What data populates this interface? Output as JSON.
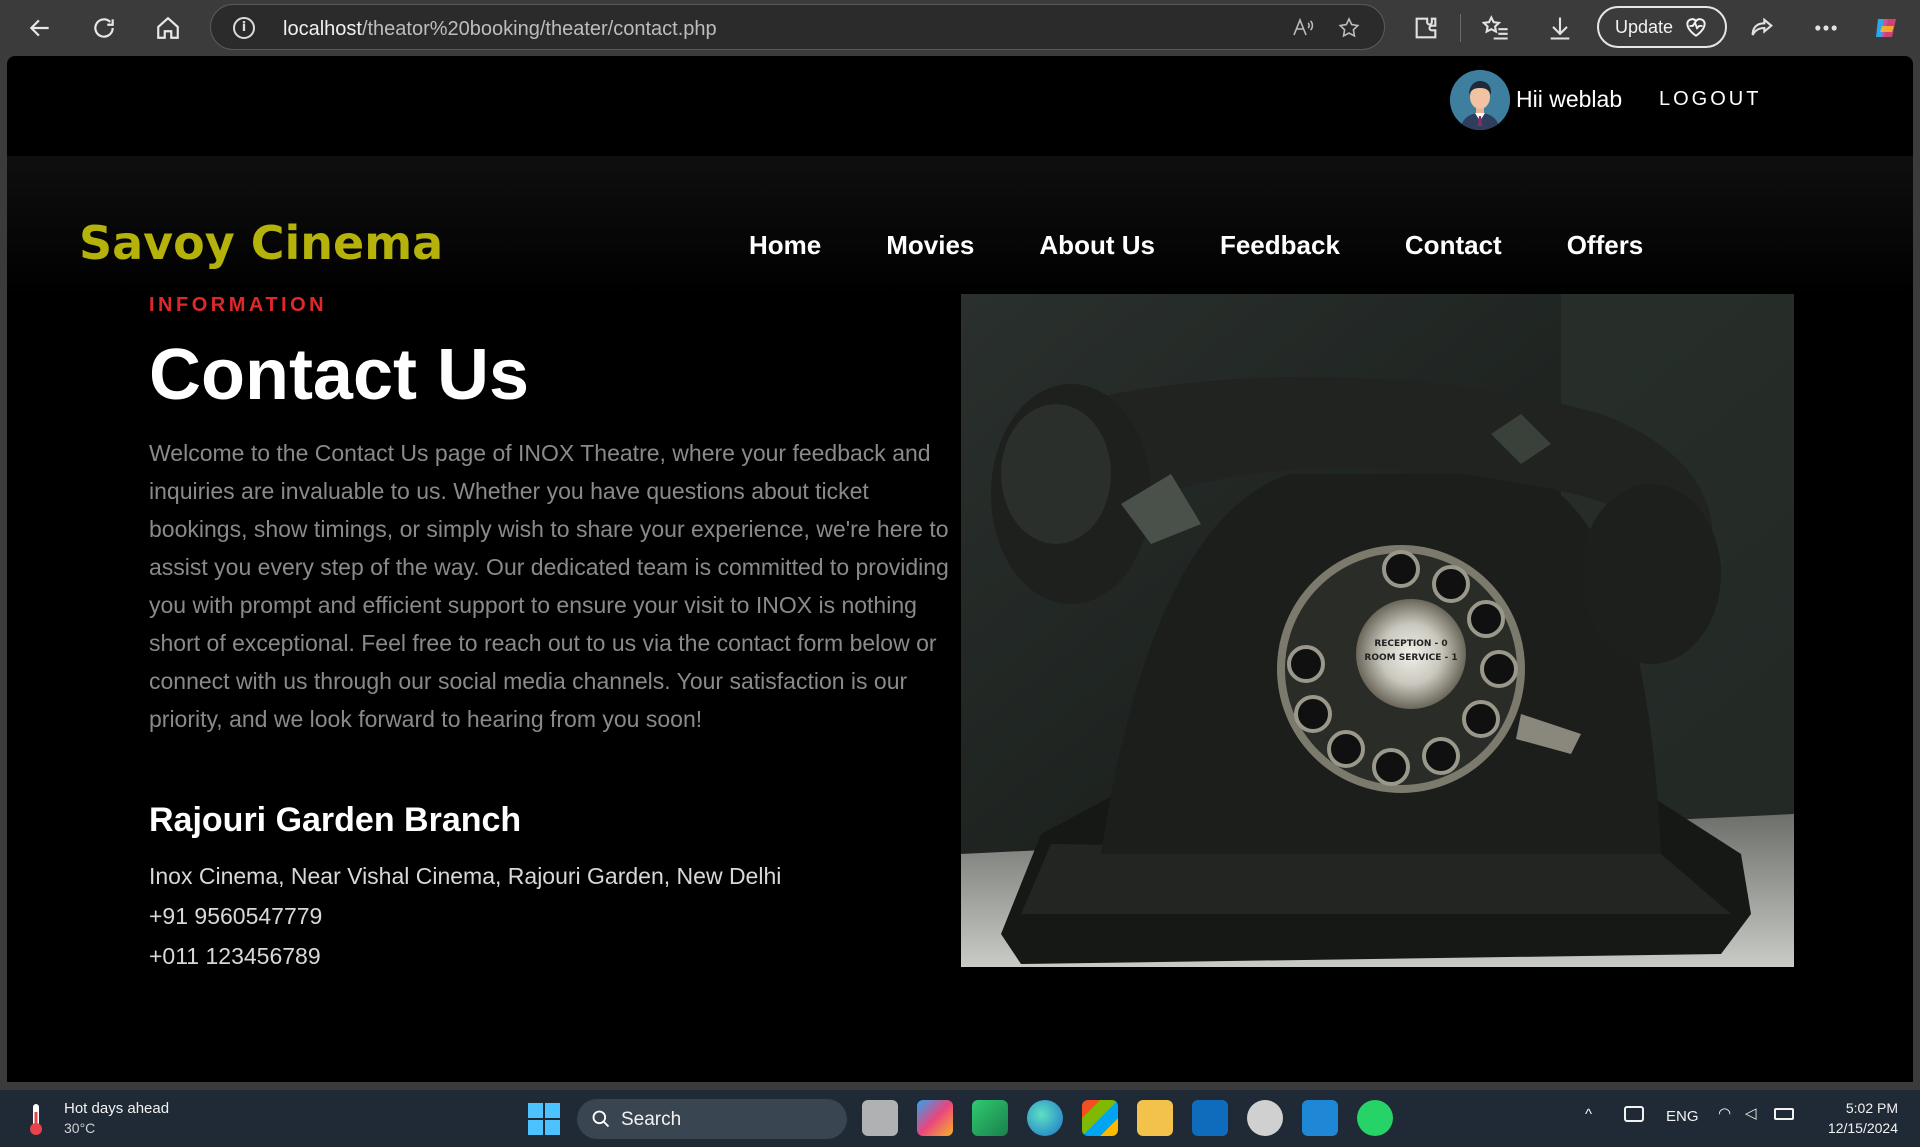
{
  "browser": {
    "url_host": "localhost",
    "url_path": "/theator%20booking/theater/contact.php",
    "update_label": "Update"
  },
  "user": {
    "greeting": "Hii weblab",
    "logout_label": "LOGOUT"
  },
  "site": {
    "brand": "Savoy Cinema",
    "brand_color": "#b5b20b",
    "nav": [
      {
        "label": "Home"
      },
      {
        "label": "Movies"
      },
      {
        "label": "About Us"
      },
      {
        "label": "Feedback"
      },
      {
        "label": "Contact"
      },
      {
        "label": "Offers"
      }
    ]
  },
  "content": {
    "section_label": "INFORMATION",
    "section_label_color": "#e02828",
    "title": "Contact Us",
    "intro": "Welcome to the Contact Us page of INOX Theatre, where your feedback and inquiries are invaluable to us. Whether you have questions about ticket bookings, show timings, or simply wish to share your experience, we're here to assist you every step of the way. Our dedicated team is committed to providing you with prompt and efficient support to ensure your visit to INOX is nothing short of exceptional. Feel free to reach out to us via the contact form below or connect with us through our social media channels. Your satisfaction is our priority, and we look forward to hearing from you soon!",
    "branch_name": "Rajouri Garden Branch",
    "address": "Inox Cinema, Near Vishal Cinema, Rajouri Garden, New Delhi",
    "phone_1": "+91 9560547779",
    "phone_2": "+011 123456789",
    "image_dial_text_1": "RECEPTION - 0",
    "image_dial_text_2": "ROOM SERVICE - 1"
  },
  "taskbar": {
    "weather_title": "Hot days ahead",
    "weather_temp": "30°C",
    "search_label": "Search",
    "language": "ENG",
    "time": "5:02 PM",
    "date": "12/15/2024"
  }
}
